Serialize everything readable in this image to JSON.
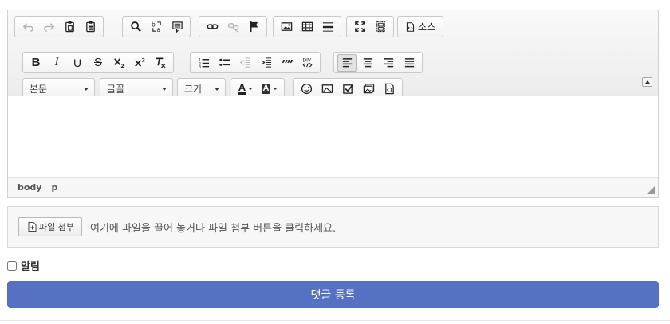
{
  "toolbar": {
    "row1": {
      "history": [
        {
          "name": "undo",
          "icon": "undo-icon",
          "disabled": true
        },
        {
          "name": "redo",
          "icon": "redo-icon",
          "disabled": true
        },
        {
          "name": "paste",
          "icon": "paste-icon"
        },
        {
          "name": "paste-word",
          "icon": "paste-word-icon"
        }
      ],
      "find": [
        {
          "name": "find",
          "icon": "search-icon"
        },
        {
          "name": "replace",
          "icon": "replace-icon"
        },
        {
          "name": "select-all",
          "icon": "select-all-icon"
        }
      ],
      "links": [
        {
          "name": "link",
          "icon": "link-icon"
        },
        {
          "name": "unlink",
          "icon": "unlink-icon",
          "disabled": true
        },
        {
          "name": "anchor",
          "icon": "flag-icon"
        }
      ],
      "insert": [
        {
          "name": "image",
          "icon": "image-icon"
        },
        {
          "name": "table",
          "icon": "table-icon"
        },
        {
          "name": "horizontal-rule",
          "icon": "horizontal-rule-icon"
        }
      ],
      "view": [
        {
          "name": "maximize",
          "icon": "maximize-icon"
        },
        {
          "name": "show-blocks",
          "icon": "show-blocks-icon"
        }
      ],
      "source_label": "소스"
    },
    "row2": {
      "basic": [
        {
          "name": "bold",
          "glyph": "B",
          "icon": "bold-icon"
        },
        {
          "name": "italic",
          "glyph": "I",
          "icon": "italic-icon"
        },
        {
          "name": "underline",
          "glyph": "U",
          "icon": "underline-icon"
        },
        {
          "name": "strike",
          "glyph": "S",
          "icon": "strikethrough-icon"
        },
        {
          "name": "subscript",
          "icon": "subscript-icon"
        },
        {
          "name": "superscript",
          "icon": "superscript-icon"
        },
        {
          "name": "remove-format",
          "icon": "remove-format-icon"
        }
      ],
      "lists": [
        {
          "name": "numbered-list",
          "icon": "numbered-list-icon"
        },
        {
          "name": "bulleted-list",
          "icon": "bulleted-list-icon"
        },
        {
          "name": "outdent",
          "icon": "outdent-icon",
          "disabled": true
        },
        {
          "name": "indent",
          "icon": "indent-icon"
        },
        {
          "name": "blockquote",
          "icon": "blockquote-icon"
        },
        {
          "name": "div",
          "icon": "div-icon"
        }
      ],
      "align": [
        {
          "name": "align-left",
          "icon": "align-left-icon",
          "active": true
        },
        {
          "name": "align-center",
          "icon": "align-center-icon"
        },
        {
          "name": "align-right",
          "icon": "align-right-icon"
        },
        {
          "name": "align-justify",
          "icon": "align-justify-icon"
        }
      ]
    },
    "row3": {
      "format_label": "본문",
      "font_label": "글꼴",
      "size_label": "크기",
      "colors": [
        {
          "name": "text-color",
          "icon": "text-color-icon",
          "glyph": "A"
        },
        {
          "name": "bg-color",
          "icon": "background-color-icon",
          "glyph": "A"
        }
      ],
      "extras": [
        {
          "name": "emoji",
          "icon": "emoji-icon"
        },
        {
          "name": "image-insert",
          "icon": "insert-image-icon"
        },
        {
          "name": "checkbox",
          "icon": "checkbox-icon"
        },
        {
          "name": "media",
          "icon": "media-icon"
        },
        {
          "name": "html-file",
          "icon": "html-file-icon"
        }
      ]
    }
  },
  "statusbar": {
    "path": [
      "body",
      "p"
    ]
  },
  "upload": {
    "button_label": "파일 첨부",
    "hint": "여기에 파일을 끌어 놓거나 파일 첨부 버튼을 클릭하세요."
  },
  "notify": {
    "label": "알림",
    "checked": false
  },
  "submit": {
    "label": "댓글 등록",
    "color": "#5670c2"
  }
}
